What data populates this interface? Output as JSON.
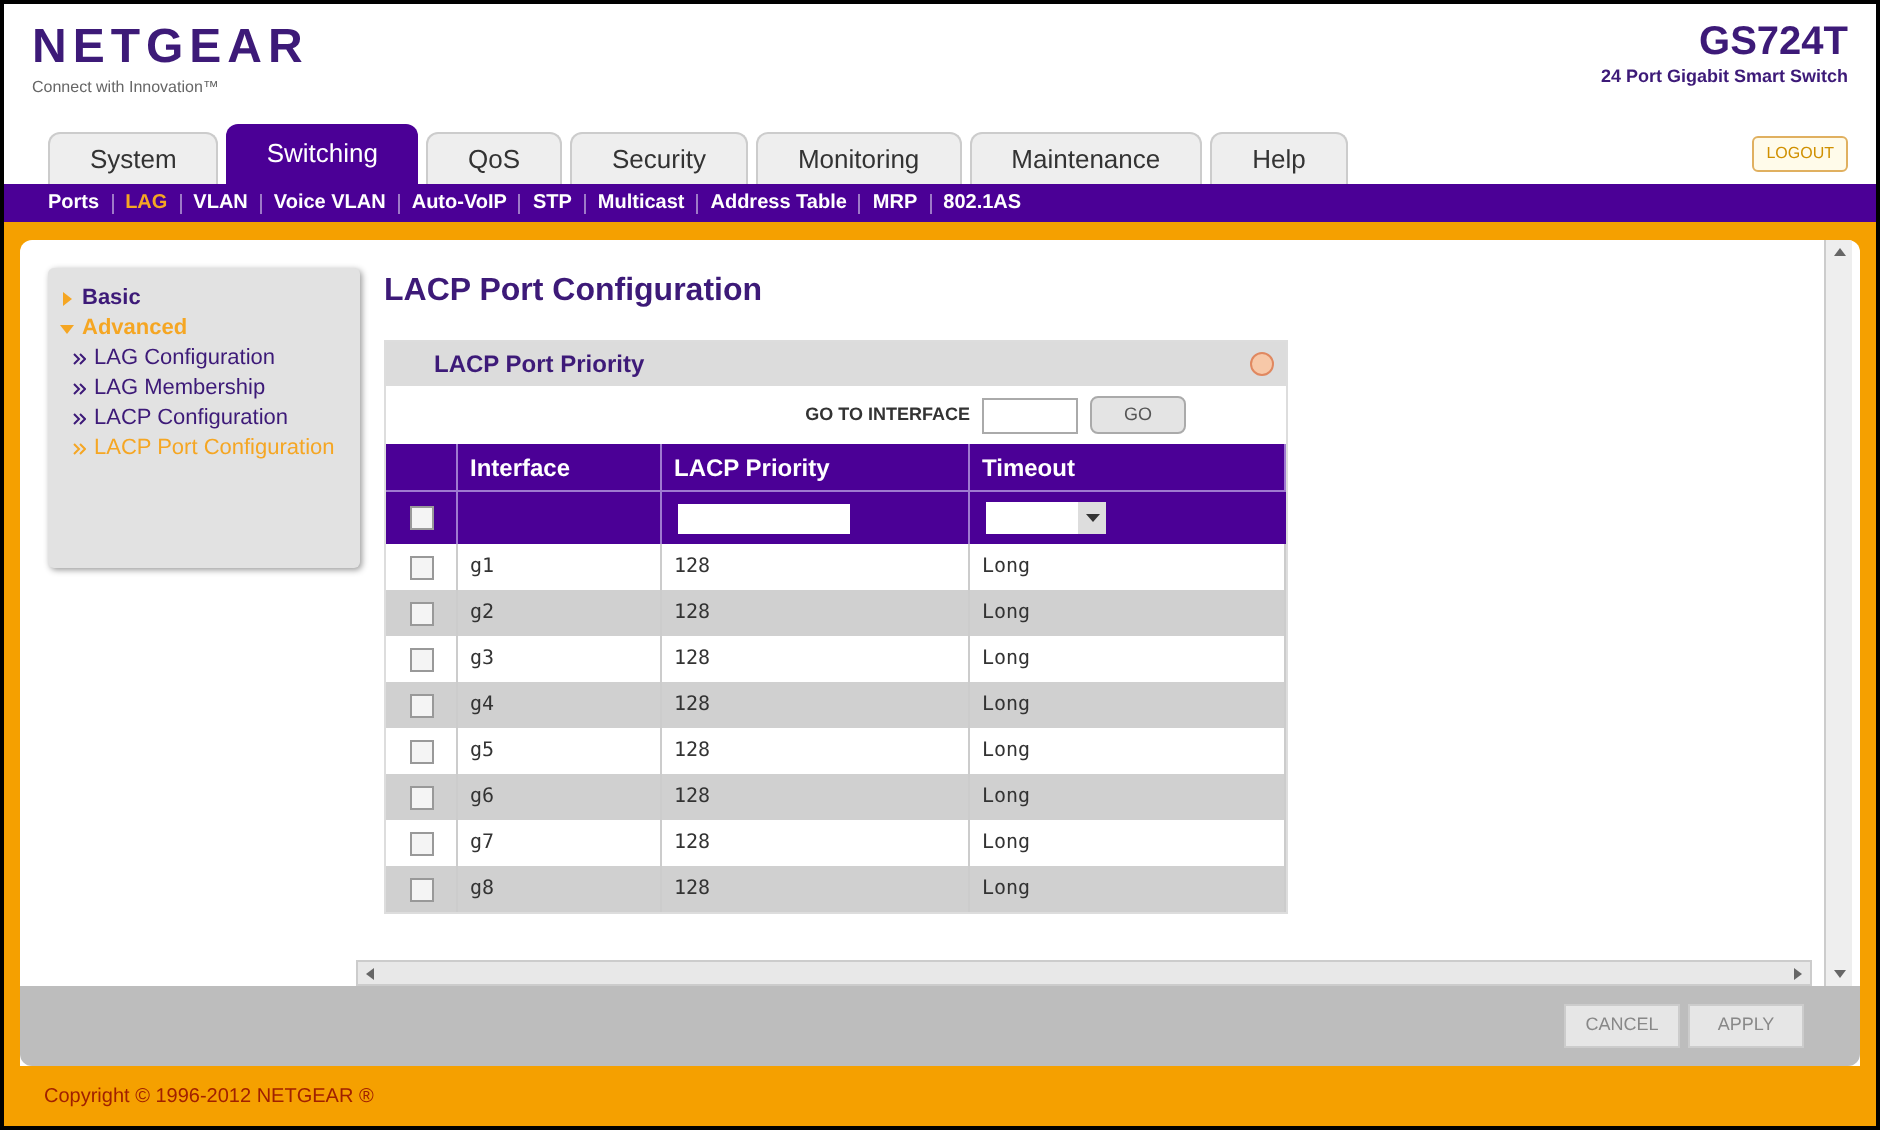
{
  "header": {
    "logo": "NETGEAR",
    "tagline": "Connect with Innovation™",
    "model": "GS724T",
    "model_subtitle": "24 Port Gigabit Smart Switch",
    "logout": "LOGOUT"
  },
  "tabs": [
    {
      "label": "System",
      "selected": false
    },
    {
      "label": "Switching",
      "selected": true
    },
    {
      "label": "QoS",
      "selected": false
    },
    {
      "label": "Security",
      "selected": false
    },
    {
      "label": "Monitoring",
      "selected": false
    },
    {
      "label": "Maintenance",
      "selected": false
    },
    {
      "label": "Help",
      "selected": false
    }
  ],
  "subnav": [
    {
      "label": "Ports",
      "selected": false
    },
    {
      "label": "LAG",
      "selected": true
    },
    {
      "label": "VLAN",
      "selected": false
    },
    {
      "label": "Voice VLAN",
      "selected": false
    },
    {
      "label": "Auto-VoIP",
      "selected": false
    },
    {
      "label": "STP",
      "selected": false
    },
    {
      "label": "Multicast",
      "selected": false
    },
    {
      "label": "Address Table",
      "selected": false
    },
    {
      "label": "MRP",
      "selected": false
    },
    {
      "label": "802.1AS",
      "selected": false
    }
  ],
  "sidebar": {
    "items": [
      {
        "label": "Basic",
        "selected": false,
        "expanded": false
      },
      {
        "label": "Advanced",
        "selected": true,
        "expanded": true,
        "children": [
          {
            "label": "LAG Configuration",
            "selected": false
          },
          {
            "label": "LAG Membership",
            "selected": false
          },
          {
            "label": "LACP Configuration",
            "selected": false
          },
          {
            "label": "LACP Port Configuration",
            "selected": true
          }
        ]
      }
    ]
  },
  "page_title": "LACP Port Configuration",
  "panel": {
    "title": "LACP Port Priority",
    "goto_label": "GO TO INTERFACE",
    "go_button": "GO",
    "columns": [
      "Interface",
      "LACP Priority",
      "Timeout"
    ],
    "select_all_checked": false,
    "rows": [
      {
        "interface": "g1",
        "priority": "128",
        "timeout": "Long",
        "checked": false
      },
      {
        "interface": "g2",
        "priority": "128",
        "timeout": "Long",
        "checked": false
      },
      {
        "interface": "g3",
        "priority": "128",
        "timeout": "Long",
        "checked": false
      },
      {
        "interface": "g4",
        "priority": "128",
        "timeout": "Long",
        "checked": false
      },
      {
        "interface": "g5",
        "priority": "128",
        "timeout": "Long",
        "checked": false
      },
      {
        "interface": "g6",
        "priority": "128",
        "timeout": "Long",
        "checked": false
      },
      {
        "interface": "g7",
        "priority": "128",
        "timeout": "Long",
        "checked": false
      },
      {
        "interface": "g8",
        "priority": "128",
        "timeout": "Long",
        "checked": false
      }
    ]
  },
  "buttons": [
    "CANCEL",
    "APPLY"
  ],
  "copyright": "Copyright © 1996-2012 NETGEAR ®"
}
